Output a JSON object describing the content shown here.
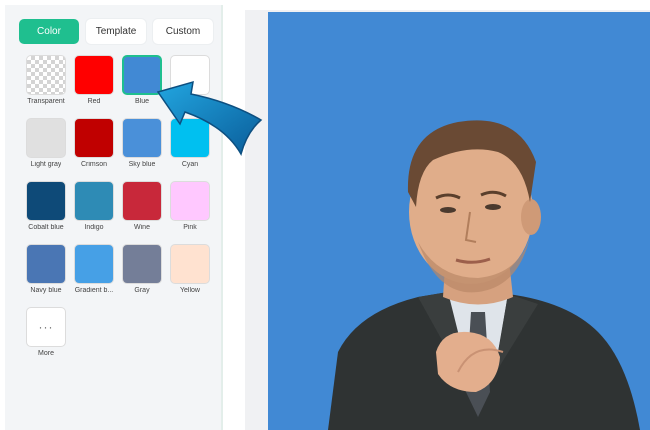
{
  "tabs": [
    {
      "label": "Color",
      "active": true
    },
    {
      "label": "Template",
      "active": false
    },
    {
      "label": "Custom",
      "active": false
    }
  ],
  "swatches": [
    {
      "label": "Transparent",
      "color": "transparent"
    },
    {
      "label": "Red",
      "color": "#ff0000"
    },
    {
      "label": "Blue",
      "color": "#4189d4",
      "selected": true
    },
    {
      "label": "",
      "color": "#ffffff"
    },
    {
      "label": "Light gray",
      "color": "#e0e0e0"
    },
    {
      "label": "Crimson",
      "color": "#c00000"
    },
    {
      "label": "Sky blue",
      "color": "#4a90d9"
    },
    {
      "label": "Cyan",
      "color": "#00c0f0"
    },
    {
      "label": "Cobalt blue",
      "color": "#0e4a78"
    },
    {
      "label": "Indigo",
      "color": "#2e8bb5"
    },
    {
      "label": "Wine",
      "color": "#c8283a"
    },
    {
      "label": "Pink",
      "color": "#ffc8ff"
    },
    {
      "label": "Navy blue",
      "color": "#4a76b4"
    },
    {
      "label": "Gradient b...",
      "color": "#46a0e6"
    },
    {
      "label": "Gray",
      "color": "#747e98"
    },
    {
      "label": "Yellow",
      "color": "#ffe2d0"
    }
  ],
  "more": {
    "label": "More",
    "icon": "more-dots-icon",
    "glyph": "···"
  },
  "preview": {
    "background": "#4189d4",
    "subject": "man-in-suit-photo"
  },
  "colors": {
    "accent": "#1fbf8f",
    "arrow": "#1587c8"
  }
}
